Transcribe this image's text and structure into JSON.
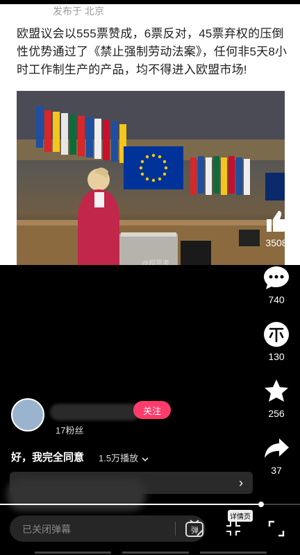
{
  "post": {
    "location": "发布于 北京",
    "headline": "欧盟议会以555票赞成，6票反对，45票弃权的压倒性优势通过了《禁止强制劳动法案》，任何非5天8小时工作制生产的产品，均不得进入欧盟市场!",
    "watermark": "@超思考"
  },
  "actions": {
    "likes": "3508",
    "comments": "740",
    "coins": "130",
    "favorites": "256",
    "shares": "37"
  },
  "author": {
    "follow_label": "关注",
    "fans": "17粉丝"
  },
  "video": {
    "caption": "好，我完全同意",
    "plays": "1.5万播放",
    "progress_fraction": 0.87
  },
  "controls": {
    "danmaku_placeholder": "已关闭弹幕",
    "danmaku_icon_text": "弹",
    "detail_label": "详情页"
  },
  "colors": {
    "follow_bg": "#ff3b6b",
    "eu_flag": "#003399",
    "eu_star": "#ffcc00"
  }
}
